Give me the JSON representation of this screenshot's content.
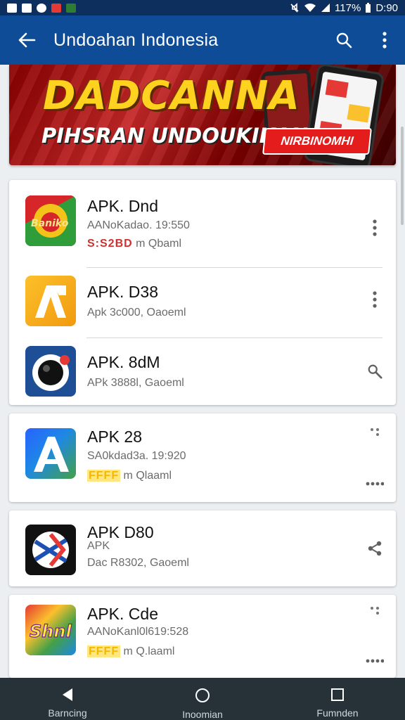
{
  "status_bar": {
    "battery_text": "117%",
    "time": "D:90"
  },
  "app_bar": {
    "title": "Undoahan Indonesia"
  },
  "banner": {
    "headline": "DADCANNA",
    "subline": "PIHSRAN UNDOUKIKAN",
    "badge": "NIRBINOMHI"
  },
  "cards": [
    {
      "items": [
        {
          "title": "APK. Dnd",
          "line1": "AANoKadao. 19:550",
          "rating": "S:S2BD",
          "line2_rest": "m  Qbaml",
          "action": "more-vertical"
        },
        {
          "title": "APK. D38",
          "line1": "Apk 3c000, Oaoeml",
          "action": "more-vertical"
        },
        {
          "title": "APK. 8dM",
          "line1": "APk 3888l, Gaoeml",
          "action": "search"
        }
      ]
    },
    {
      "items": [
        {
          "title": "APK 28",
          "line1": "SA0kdad3a. 19:920",
          "rating": "FFFF",
          "line2_rest": "m  Qlaaml",
          "action": "dots"
        }
      ]
    },
    {
      "items": [
        {
          "title": "APK D80",
          "line1": "APK",
          "line2": "Dac R8302, Gaoeml",
          "action": "share"
        }
      ]
    },
    {
      "items": [
        {
          "title": "APK. Cde",
          "line1": "AANoKanl0l619:528",
          "rating": "FFFF",
          "line2_rest": "m  Q.laaml",
          "action": "dots"
        }
      ]
    }
  ],
  "nav_bar": {
    "items": [
      {
        "label": "Barncing",
        "icon": "back-triangle-icon"
      },
      {
        "label": "Inoomian",
        "icon": "home-circle-icon"
      },
      {
        "label": "Fumnden",
        "icon": "recents-square-icon"
      }
    ]
  },
  "colors": {
    "status_bar": "#0d2f5e",
    "app_bar": "#0f4c97",
    "nav_bar": "#263238",
    "background": "#eceff1"
  }
}
